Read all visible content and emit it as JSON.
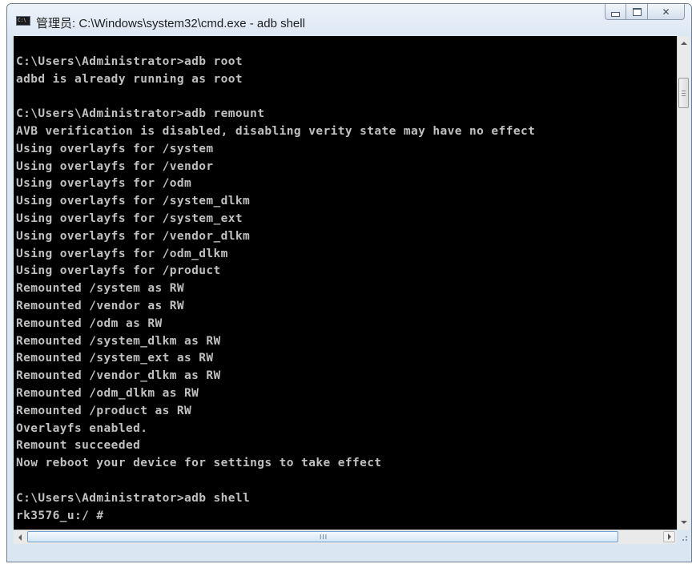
{
  "window": {
    "title": "管理员: C:\\Windows\\system32\\cmd.exe - adb  shell",
    "icon": "cmd-icon",
    "icon_text": "C:\\",
    "buttons": {
      "minimize_icon": "minimize-icon",
      "maximize_icon": "maximize-icon",
      "close_icon": "close-icon",
      "close_glyph": "✕"
    }
  },
  "console": {
    "background": "#000000",
    "foreground": "#c0c0c0",
    "lines": [
      "",
      "C:\\Users\\Administrator>adb root",
      "adbd is already running as root",
      "",
      "C:\\Users\\Administrator>adb remount",
      "AVB verification is disabled, disabling verity state may have no effect",
      "Using overlayfs for /system",
      "Using overlayfs for /vendor",
      "Using overlayfs for /odm",
      "Using overlayfs for /system_dlkm",
      "Using overlayfs for /system_ext",
      "Using overlayfs for /vendor_dlkm",
      "Using overlayfs for /odm_dlkm",
      "Using overlayfs for /product",
      "Remounted /system as RW",
      "Remounted /vendor as RW",
      "Remounted /odm as RW",
      "Remounted /system_dlkm as RW",
      "Remounted /system_ext as RW",
      "Remounted /vendor_dlkm as RW",
      "Remounted /odm_dlkm as RW",
      "Remounted /product as RW",
      "Overlayfs enabled.",
      "Remount succeeded",
      "Now reboot your device for settings to take effect",
      "",
      "C:\\Users\\Administrator>adb shell",
      "rk3576_u:/ #"
    ]
  },
  "scrollbars": {
    "horizontal_grip": "III",
    "icons": {
      "up": "scroll-up-arrow-icon",
      "down": "scroll-down-arrow-icon",
      "left": "scroll-left-arrow-icon",
      "right": "scroll-right-arrow-icon"
    }
  }
}
